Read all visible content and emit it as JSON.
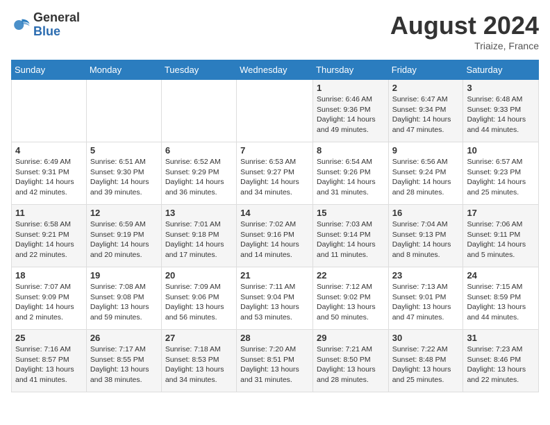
{
  "header": {
    "logo_general": "General",
    "logo_blue": "Blue",
    "month_year": "August 2024",
    "location": "Triaize, France"
  },
  "days_of_week": [
    "Sunday",
    "Monday",
    "Tuesday",
    "Wednesday",
    "Thursday",
    "Friday",
    "Saturday"
  ],
  "weeks": [
    [
      {
        "day": "",
        "info": ""
      },
      {
        "day": "",
        "info": ""
      },
      {
        "day": "",
        "info": ""
      },
      {
        "day": "",
        "info": ""
      },
      {
        "day": "1",
        "info": "Sunrise: 6:46 AM\nSunset: 9:36 PM\nDaylight: 14 hours and 49 minutes."
      },
      {
        "day": "2",
        "info": "Sunrise: 6:47 AM\nSunset: 9:34 PM\nDaylight: 14 hours and 47 minutes."
      },
      {
        "day": "3",
        "info": "Sunrise: 6:48 AM\nSunset: 9:33 PM\nDaylight: 14 hours and 44 minutes."
      }
    ],
    [
      {
        "day": "4",
        "info": "Sunrise: 6:49 AM\nSunset: 9:31 PM\nDaylight: 14 hours and 42 minutes."
      },
      {
        "day": "5",
        "info": "Sunrise: 6:51 AM\nSunset: 9:30 PM\nDaylight: 14 hours and 39 minutes."
      },
      {
        "day": "6",
        "info": "Sunrise: 6:52 AM\nSunset: 9:29 PM\nDaylight: 14 hours and 36 minutes."
      },
      {
        "day": "7",
        "info": "Sunrise: 6:53 AM\nSunset: 9:27 PM\nDaylight: 14 hours and 34 minutes."
      },
      {
        "day": "8",
        "info": "Sunrise: 6:54 AM\nSunset: 9:26 PM\nDaylight: 14 hours and 31 minutes."
      },
      {
        "day": "9",
        "info": "Sunrise: 6:56 AM\nSunset: 9:24 PM\nDaylight: 14 hours and 28 minutes."
      },
      {
        "day": "10",
        "info": "Sunrise: 6:57 AM\nSunset: 9:23 PM\nDaylight: 14 hours and 25 minutes."
      }
    ],
    [
      {
        "day": "11",
        "info": "Sunrise: 6:58 AM\nSunset: 9:21 PM\nDaylight: 14 hours and 22 minutes."
      },
      {
        "day": "12",
        "info": "Sunrise: 6:59 AM\nSunset: 9:19 PM\nDaylight: 14 hours and 20 minutes."
      },
      {
        "day": "13",
        "info": "Sunrise: 7:01 AM\nSunset: 9:18 PM\nDaylight: 14 hours and 17 minutes."
      },
      {
        "day": "14",
        "info": "Sunrise: 7:02 AM\nSunset: 9:16 PM\nDaylight: 14 hours and 14 minutes."
      },
      {
        "day": "15",
        "info": "Sunrise: 7:03 AM\nSunset: 9:14 PM\nDaylight: 14 hours and 11 minutes."
      },
      {
        "day": "16",
        "info": "Sunrise: 7:04 AM\nSunset: 9:13 PM\nDaylight: 14 hours and 8 minutes."
      },
      {
        "day": "17",
        "info": "Sunrise: 7:06 AM\nSunset: 9:11 PM\nDaylight: 14 hours and 5 minutes."
      }
    ],
    [
      {
        "day": "18",
        "info": "Sunrise: 7:07 AM\nSunset: 9:09 PM\nDaylight: 14 hours and 2 minutes."
      },
      {
        "day": "19",
        "info": "Sunrise: 7:08 AM\nSunset: 9:08 PM\nDaylight: 13 hours and 59 minutes."
      },
      {
        "day": "20",
        "info": "Sunrise: 7:09 AM\nSunset: 9:06 PM\nDaylight: 13 hours and 56 minutes."
      },
      {
        "day": "21",
        "info": "Sunrise: 7:11 AM\nSunset: 9:04 PM\nDaylight: 13 hours and 53 minutes."
      },
      {
        "day": "22",
        "info": "Sunrise: 7:12 AM\nSunset: 9:02 PM\nDaylight: 13 hours and 50 minutes."
      },
      {
        "day": "23",
        "info": "Sunrise: 7:13 AM\nSunset: 9:01 PM\nDaylight: 13 hours and 47 minutes."
      },
      {
        "day": "24",
        "info": "Sunrise: 7:15 AM\nSunset: 8:59 PM\nDaylight: 13 hours and 44 minutes."
      }
    ],
    [
      {
        "day": "25",
        "info": "Sunrise: 7:16 AM\nSunset: 8:57 PM\nDaylight: 13 hours and 41 minutes."
      },
      {
        "day": "26",
        "info": "Sunrise: 7:17 AM\nSunset: 8:55 PM\nDaylight: 13 hours and 38 minutes."
      },
      {
        "day": "27",
        "info": "Sunrise: 7:18 AM\nSunset: 8:53 PM\nDaylight: 13 hours and 34 minutes."
      },
      {
        "day": "28",
        "info": "Sunrise: 7:20 AM\nSunset: 8:51 PM\nDaylight: 13 hours and 31 minutes."
      },
      {
        "day": "29",
        "info": "Sunrise: 7:21 AM\nSunset: 8:50 PM\nDaylight: 13 hours and 28 minutes."
      },
      {
        "day": "30",
        "info": "Sunrise: 7:22 AM\nSunset: 8:48 PM\nDaylight: 13 hours and 25 minutes."
      },
      {
        "day": "31",
        "info": "Sunrise: 7:23 AM\nSunset: 8:46 PM\nDaylight: 13 hours and 22 minutes."
      }
    ]
  ]
}
